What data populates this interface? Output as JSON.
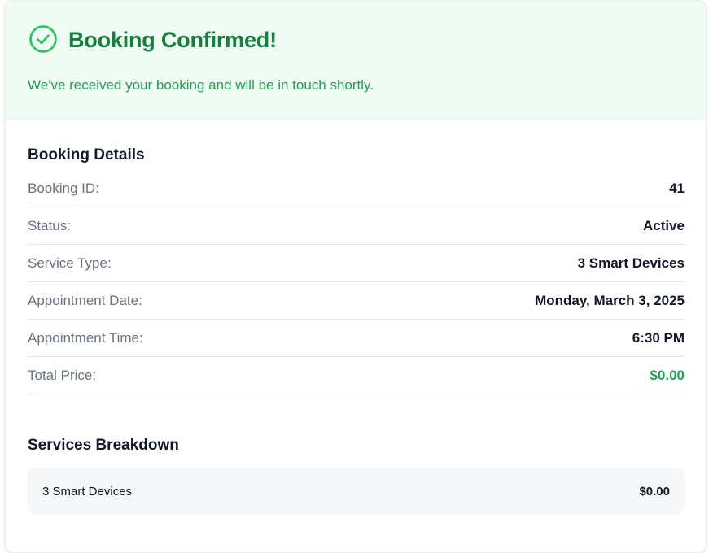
{
  "banner": {
    "icon": "check-circle-icon",
    "title": "Booking Confirmed!",
    "subtitle": "We've received your booking and will be in touch shortly."
  },
  "details": {
    "title": "Booking Details",
    "rows": [
      {
        "label": "Booking ID:",
        "value": "41"
      },
      {
        "label": "Status:",
        "value": "Active"
      },
      {
        "label": "Service Type:",
        "value": "3 Smart Devices"
      },
      {
        "label": "Appointment Date:",
        "value": "Monday, March 3, 2025"
      },
      {
        "label": "Appointment Time:",
        "value": "6:30 PM"
      },
      {
        "label": "Total Price:",
        "value": "$0.00"
      }
    ]
  },
  "breakdown": {
    "title": "Services Breakdown",
    "items": [
      {
        "name": "3 Smart Devices",
        "amount": "$0.00"
      }
    ]
  },
  "colors": {
    "accent_green": "#15803d",
    "price_green": "#22a153",
    "banner_bg": "#effbf3"
  }
}
